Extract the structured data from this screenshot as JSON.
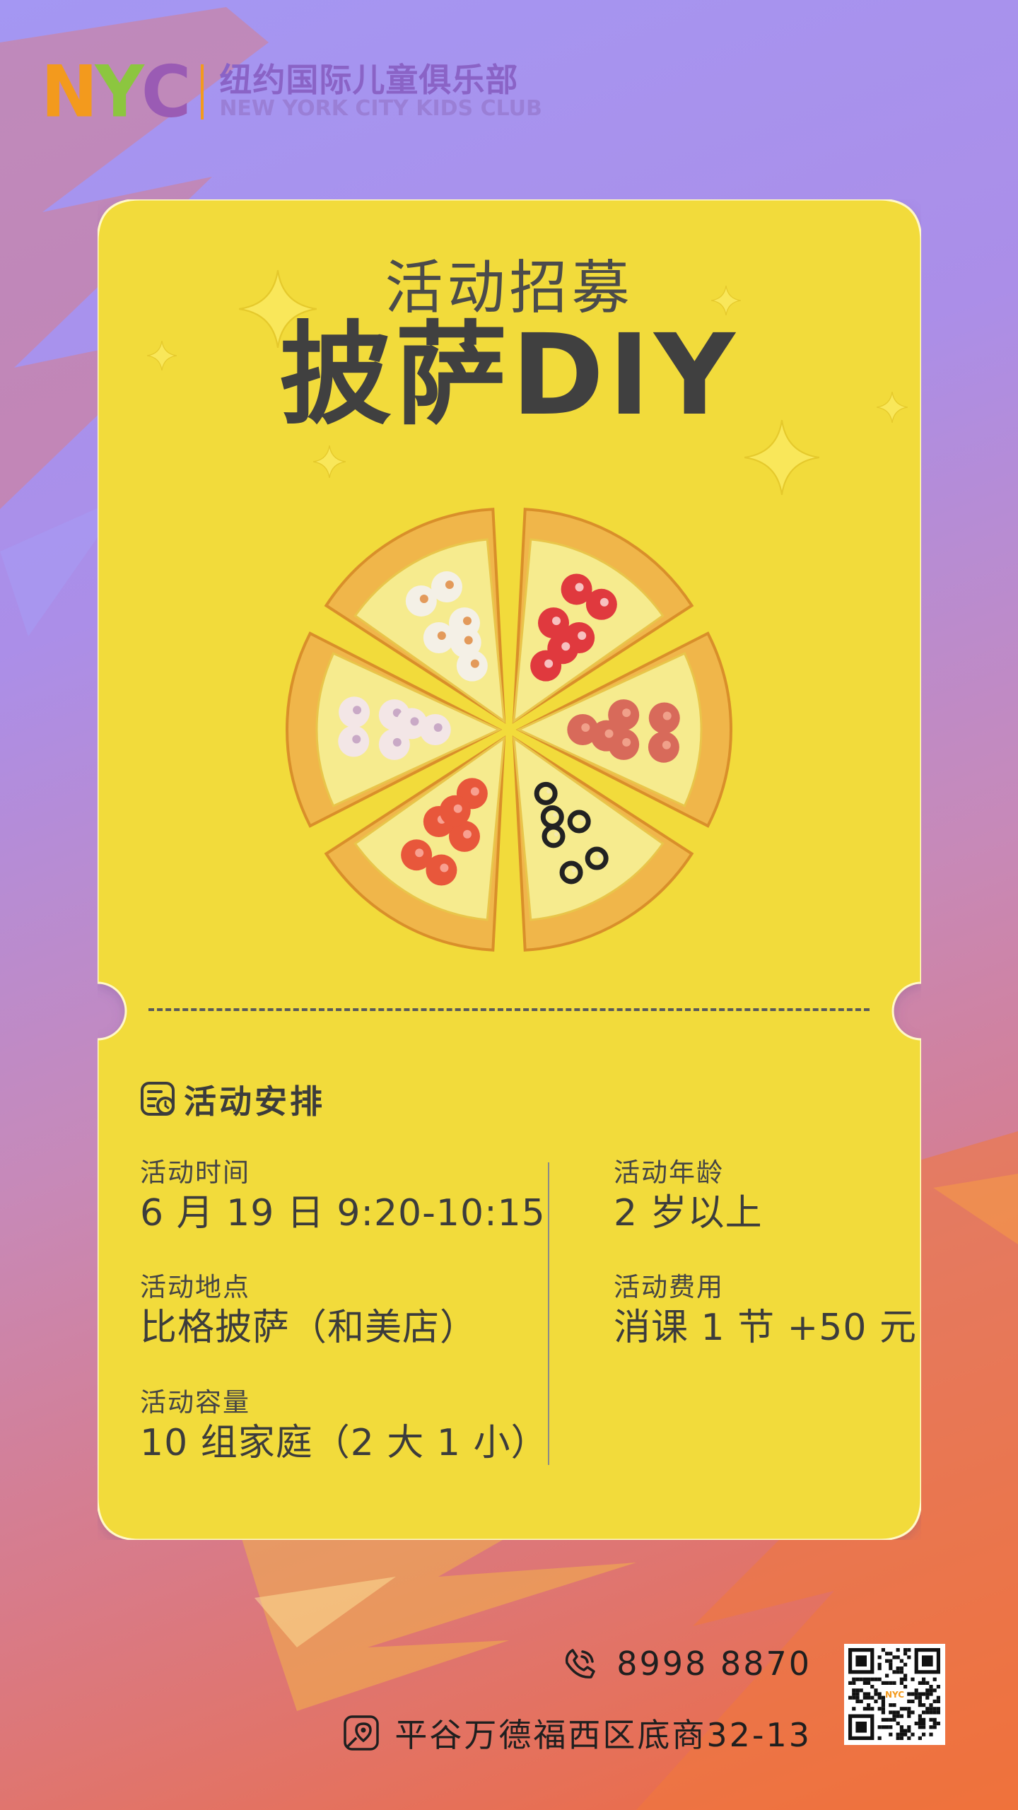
{
  "logo": {
    "nyc_n": "N",
    "nyc_y": "Y",
    "nyc_c": "C",
    "name_cn": "纽约国际儿童俱乐部",
    "name_en": "NEW YORK CITY KIDS CLUB"
  },
  "header": {
    "subtitle": "活动招募",
    "title": "披萨DIY"
  },
  "schedule": {
    "heading": "活动安排",
    "time_label": "活动时间",
    "time_value": "6 月 19 日 9:20-10:15",
    "place_label": "活动地点",
    "place_value": "比格披萨（和美店）",
    "capacity_label": "活动容量",
    "capacity_value": "10 组家庭（2 大 1 小）",
    "age_label": "活动年龄",
    "age_value": "2 岁以上",
    "fee_label": "活动费用",
    "fee_value": "消课 1 节 +50 元"
  },
  "contact": {
    "phone": "8998  8870",
    "address": "平谷万德福西区底商32-13",
    "qr_center_text": "NYC"
  },
  "colors": {
    "ticket": "#f2db3a",
    "text_dark": "#404040",
    "nyc_orange": "#f39a1d",
    "nyc_green": "#8cc63f",
    "nyc_purple": "#9a5bb4"
  },
  "icons": [
    "schedule-icon",
    "phone-icon",
    "location-icon",
    "sparkle-icon",
    "qr-code"
  ]
}
